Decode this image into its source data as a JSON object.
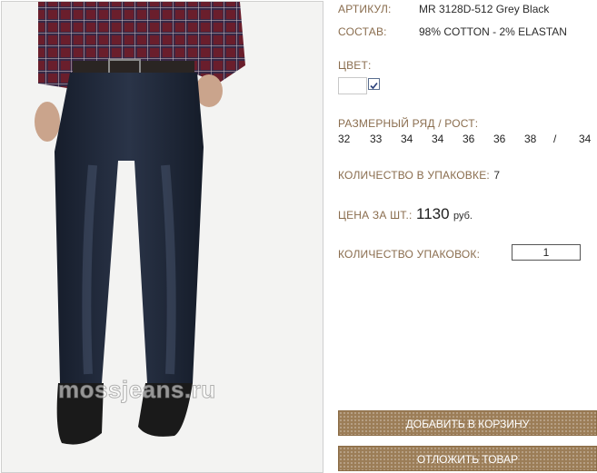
{
  "product": {
    "article_label": "АРТИКУЛ:",
    "article_value": "MR 3128D-512 Grey Black",
    "composition_label": "СОСТАВ:",
    "composition_value": "98% COTTON - 2% ELASTAN",
    "color_label": "ЦВЕТ:",
    "color_selected": true,
    "sizes_label": "РАЗМЕРНЫЙ РЯД / РОСТ:",
    "sizes": [
      "32",
      "33",
      "34",
      "34",
      "36",
      "36",
      "38",
      "/",
      "34"
    ],
    "pack_qty_label": "КОЛИЧЕСТВО В УПАКОВКЕ:",
    "pack_qty_value": "7",
    "price_label": "ЦЕНА ЗА ШТ.:",
    "price_value": "1130",
    "price_currency": "руб.",
    "packs_label": "КОЛИЧЕСТВО УПАКОВОК:",
    "packs_value": "1"
  },
  "photo": {
    "watermark": "mossjeans.ru"
  },
  "buttons": {
    "add_to_cart": "ДОБАВИТЬ В КОРЗИНУ",
    "postpone": "ОТЛОЖИТЬ ТОВАР"
  },
  "colors": {
    "label": "#8a6d4e",
    "button": "#9c7d57",
    "denim": "#1c2434"
  }
}
